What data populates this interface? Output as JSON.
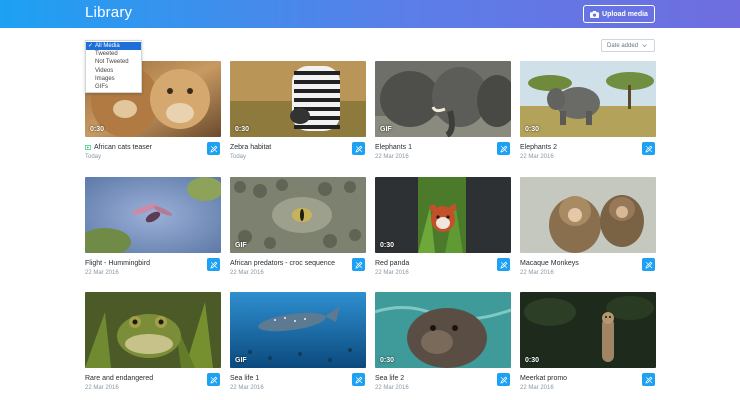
{
  "header": {
    "title": "Library",
    "upload_label": "Upload media"
  },
  "filter": {
    "options": [
      "All Media",
      "Tweeted",
      "Not Tweeted",
      "Videos",
      "Images",
      "GIFs"
    ],
    "selected_index": 0
  },
  "sort": {
    "label": "Date added"
  },
  "media": [
    {
      "title": "African cats teaser",
      "date": "Today",
      "badge": "0:30",
      "type": "video",
      "tweeted": true
    },
    {
      "title": "Zebra habitat",
      "date": "Today",
      "badge": "0:30",
      "type": "video",
      "tweeted": false
    },
    {
      "title": "Elephants 1",
      "date": "22 Mar 2016",
      "badge": "GIF",
      "type": "gif",
      "tweeted": false
    },
    {
      "title": "Elephants 2",
      "date": "22 Mar 2016",
      "badge": "0:30",
      "type": "video",
      "tweeted": false
    },
    {
      "title": "Flight - Hummingbird",
      "date": "22 Mar 2016",
      "badge": "",
      "type": "image",
      "tweeted": false
    },
    {
      "title": "African predators - croc sequence",
      "date": "22 Mar 2016",
      "badge": "GIF",
      "type": "gif",
      "tweeted": false
    },
    {
      "title": "Red panda",
      "date": "22 Mar 2016",
      "badge": "0:30",
      "type": "video",
      "tweeted": false
    },
    {
      "title": "Macaque Monkeys",
      "date": "22 Mar 2016",
      "badge": "",
      "type": "image",
      "tweeted": false
    },
    {
      "title": "Rare and endangered",
      "date": "22 Mar 2016",
      "badge": "",
      "type": "image",
      "tweeted": false
    },
    {
      "title": "Sea life 1",
      "date": "22 Mar 2016",
      "badge": "GIF",
      "type": "gif",
      "tweeted": false
    },
    {
      "title": "Sea life 2",
      "date": "22 Mar 2016",
      "badge": "0:30",
      "type": "video",
      "tweeted": false
    },
    {
      "title": "Meerkat promo",
      "date": "22 Mar 2016",
      "badge": "0:30",
      "type": "video",
      "tweeted": false
    }
  ],
  "colors": {
    "accent": "#1da1f2",
    "header_start": "#1da1f2",
    "header_end": "#6f6ddf",
    "tweeted_icon": "#17bf63"
  },
  "icons": {
    "upload": "camera-icon",
    "edit": "pencil-icon",
    "sort": "chevron-down-icon",
    "tweeted": "video-icon"
  }
}
